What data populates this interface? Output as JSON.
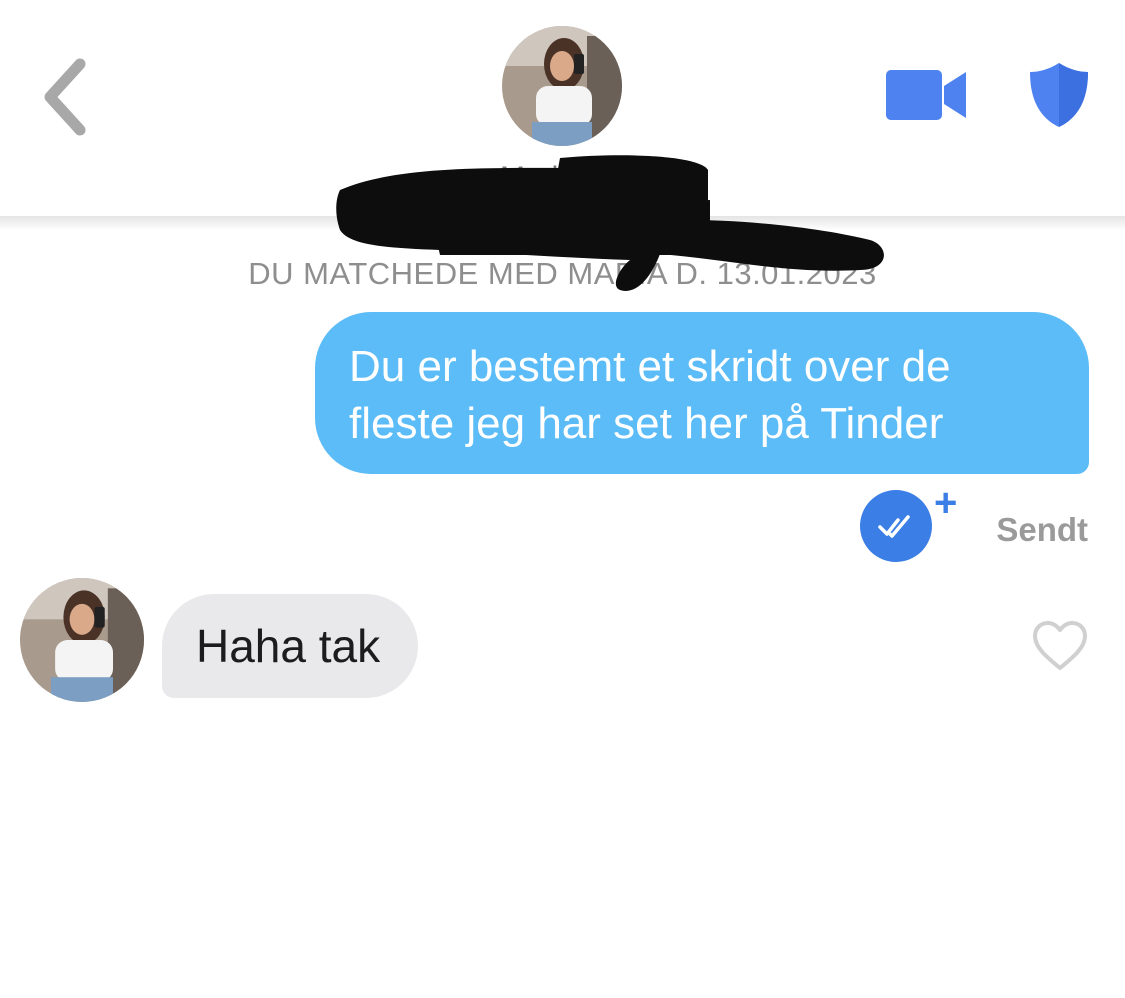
{
  "header": {
    "match_name": "Maria",
    "avatar_icon": "profile-photo",
    "back_icon": "chevron-left-icon",
    "video_icon": "video-camera-icon",
    "safety_icon": "shield-icon",
    "accent_color": "#3b7ee6"
  },
  "match_banner": {
    "text": "DU MATCHEDE MED MARIA D. 13.01.2023"
  },
  "messages": [
    {
      "direction": "sent",
      "text": "Du er bestemt et skridt over de fleste jeg har set her på Tinder",
      "status": "Sendt",
      "bubble_color": "#5bbcf7"
    },
    {
      "direction": "received",
      "text": "Haha tak",
      "bubble_color": "#e9e9eb"
    }
  ]
}
